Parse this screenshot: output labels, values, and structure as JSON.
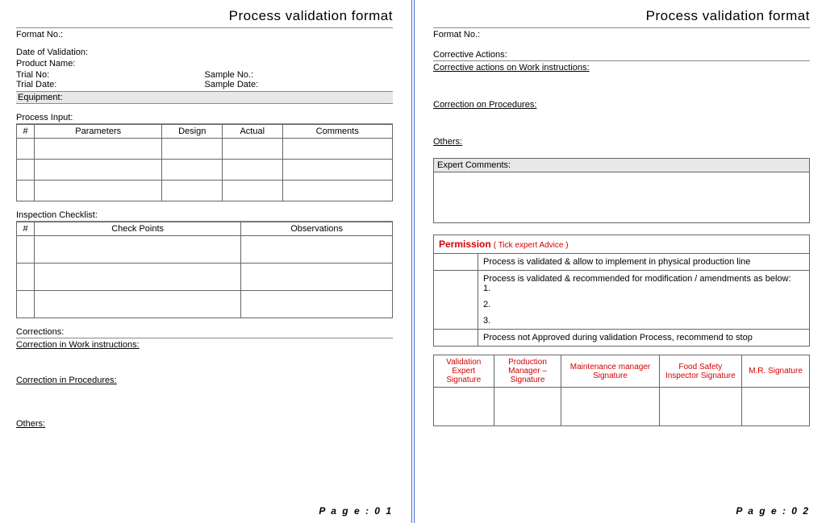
{
  "page1": {
    "title": "Process validation format",
    "format_no": "Format No.:",
    "date_of_validation": "Date of Validation:",
    "product_name": "Product Name:",
    "trial_no": "Trial No:",
    "sample_no": "Sample No.:",
    "trial_date": "Trial Date:",
    "sample_date": "Sample Date:",
    "equipment": "Equipment:",
    "process_input_head": "Process Input:",
    "pi_cols": {
      "num": "#",
      "params": "Parameters",
      "design": "Design",
      "actual": "Actual",
      "comments": "Comments"
    },
    "inspection_head": "Inspection Checklist:",
    "ic_cols": {
      "num": "#",
      "checkpoints": "Check Points",
      "obs": "Observations"
    },
    "corrections": "Corrections:",
    "corr_work": "Correction in Work instructions:",
    "corr_proc": "Correction in Procedures:",
    "others": "Others:",
    "footer": "P a g e : 0 1"
  },
  "page2": {
    "title": "Process validation format",
    "format_no": "Format No.:",
    "corrective_actions": "Corrective Actions:",
    "ca_work": "Corrective actions on Work instructions:",
    "ca_proc": "Correction on Procedures:",
    "others": "Others:",
    "expert_comments": "Expert Comments:",
    "permission_head": "Permission",
    "permission_sub": "( Tick expert Advice )",
    "perm_opt1": "Process is validated & allow to implement in physical production line",
    "perm_opt2_intro": "Process is validated & recommended for modification / amendments as below:",
    "perm_opt2_1": "1.",
    "perm_opt2_2": "2.",
    "perm_opt2_3": "3.",
    "perm_opt3": "Process not Approved during validation Process, recommend to stop",
    "sig": {
      "s1": "Validation Expert Signature",
      "s2": "Production Manager – Signature",
      "s3": "Maintenance manager Signature",
      "s4": "Food Safety Inspector Signature",
      "s5": "M.R. Signature"
    },
    "footer": "P a g e : 0 2"
  }
}
